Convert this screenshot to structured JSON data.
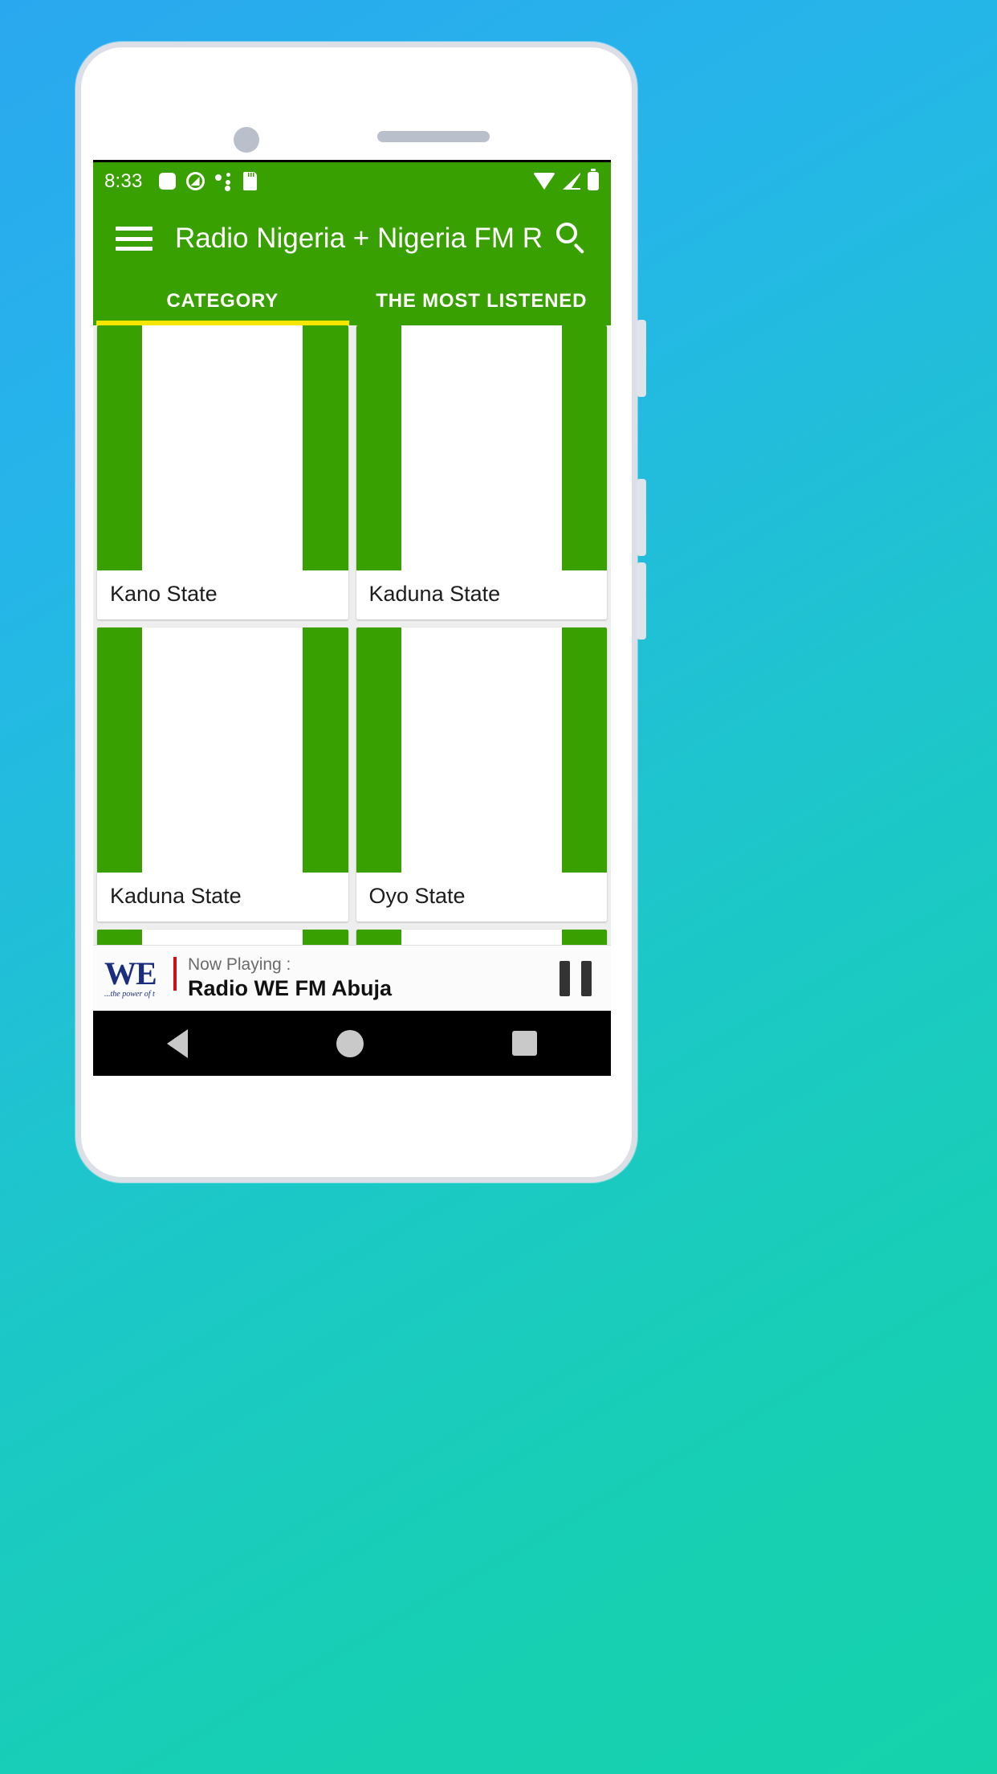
{
  "status_bar": {
    "time": "8:33",
    "left_icons": [
      "square-icon",
      "circle-slash-icon",
      "dots-icon",
      "sd-card-icon"
    ],
    "right_icons": [
      "wifi-icon",
      "cell-signal-icon",
      "battery-icon"
    ]
  },
  "app_bar": {
    "menu_icon": "hamburger-menu-icon",
    "title": "Radio Nigeria + Nigeria FM R...",
    "search_icon": "search-icon"
  },
  "tabs": [
    {
      "label": "CATEGORY",
      "active": true
    },
    {
      "label": "THE MOST LISTENED",
      "active": false
    }
  ],
  "cards": [
    {
      "label": "Kano State"
    },
    {
      "label": "Kaduna State"
    },
    {
      "label": "Kaduna State"
    },
    {
      "label": "Oyo State"
    }
  ],
  "player": {
    "logo_text": "WE",
    "logo_sub": "...the power of t",
    "now_playing_label": "Now Playing :",
    "station": "Radio WE FM Abuja",
    "pause_icon": "pause-icon"
  },
  "nav_bar": {
    "back": "back-triangle-icon",
    "home": "home-circle-icon",
    "recents": "recents-square-icon"
  },
  "colors": {
    "brand_green": "#38a000",
    "tab_indicator": "#f5e600",
    "backdrop_start": "#2aa8ef",
    "backdrop_end": "#16d2ab"
  }
}
